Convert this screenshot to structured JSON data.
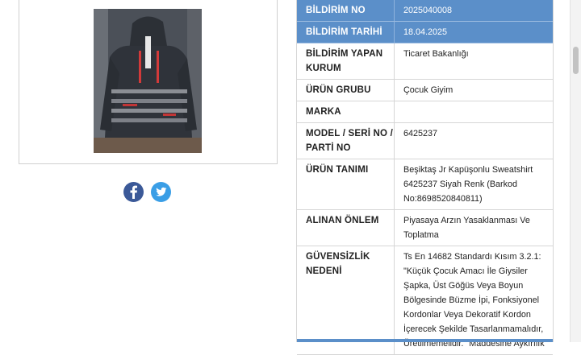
{
  "product": {
    "image_alt": "Siyah kapüşonlu sweatshirt",
    "share": {
      "facebook_icon": "facebook-icon",
      "twitter_icon": "twitter-icon"
    }
  },
  "notice": {
    "rows": [
      {
        "label": "BİLDİRİM NO",
        "value": "2025040008",
        "header": true
      },
      {
        "label": "BİLDİRİM TARİHİ",
        "value": "18.04.2025",
        "header": true
      },
      {
        "label": "BİLDİRİM YAPAN KURUM",
        "value": "Ticaret Bakanlığı"
      },
      {
        "label": "ÜRÜN GRUBU",
        "value": "Çocuk Giyim"
      },
      {
        "label": "MARKA",
        "value": ""
      },
      {
        "label": "MODEL / SERİ NO / PARTİ NO",
        "value": "6425237"
      },
      {
        "label": "ÜRÜN TANIMI",
        "value": "Beşiktaş Jr Kapüşonlu Sweatshirt 6425237 Siyah Renk (Barkod No:8698520840811)"
      },
      {
        "label": "ALINAN ÖNLEM",
        "value": "Piyasaya Arzın Yasaklanması Ve Toplatma"
      },
      {
        "label": "GÜVENSİZLİK NEDENİ",
        "value": "Ts En 14682 Standardı Kısım 3.2.1: \"Küçük Çocuk Amacı İle Giysiler Şapka, Üst Göğüs Veya Boyun Bölgesinde Büzme İpi, Fonksiyonel Kordonlar Veya Dekoratif Kordon İçerecek Şekilde Tasarlanmamalıdır, Üretilmemelidir.\" Maddesine Aykırılık"
      }
    ]
  },
  "colors": {
    "header_blue": "#5b8fc9",
    "facebook": "#3b5998",
    "twitter": "#3a9ee6"
  }
}
